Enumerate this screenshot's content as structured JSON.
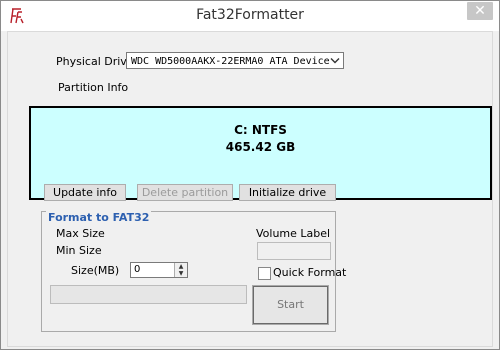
{
  "window": {
    "title": "Fat32Formatter",
    "close_glyph": "✕"
  },
  "physical_drive": {
    "label": "Physical Drive",
    "selected": "WDC WD5000AAKX-22ERMA0 ATA Device"
  },
  "partition_info": {
    "label": "Partition Info",
    "drive": "C: NTFS",
    "size": "465.42 GB",
    "background_color": "#ccffff"
  },
  "buttons": {
    "update_info": "Update info",
    "delete_partition": "Delete partition",
    "initialize_drive": "Initialize drive"
  },
  "format_group": {
    "title": "Format to FAT32",
    "max_size_label": "Max Size",
    "min_size_label": "Min Size",
    "size_mb_label": "Size(MB)",
    "size_mb_value": "0",
    "volume_label_label": "Volume Label",
    "volume_label_value": "",
    "quick_format_label": "Quick Format",
    "quick_format_checked": false,
    "progress": 0,
    "start_label": "Start"
  },
  "icons": {
    "app": "fat32-formatter-app-icon",
    "close": "close-icon",
    "dropdown": "chevron-down-icon",
    "spin_up": "spin-up-icon",
    "spin_down": "spin-down-icon"
  },
  "colors": {
    "group_title": "#2d60b0"
  }
}
